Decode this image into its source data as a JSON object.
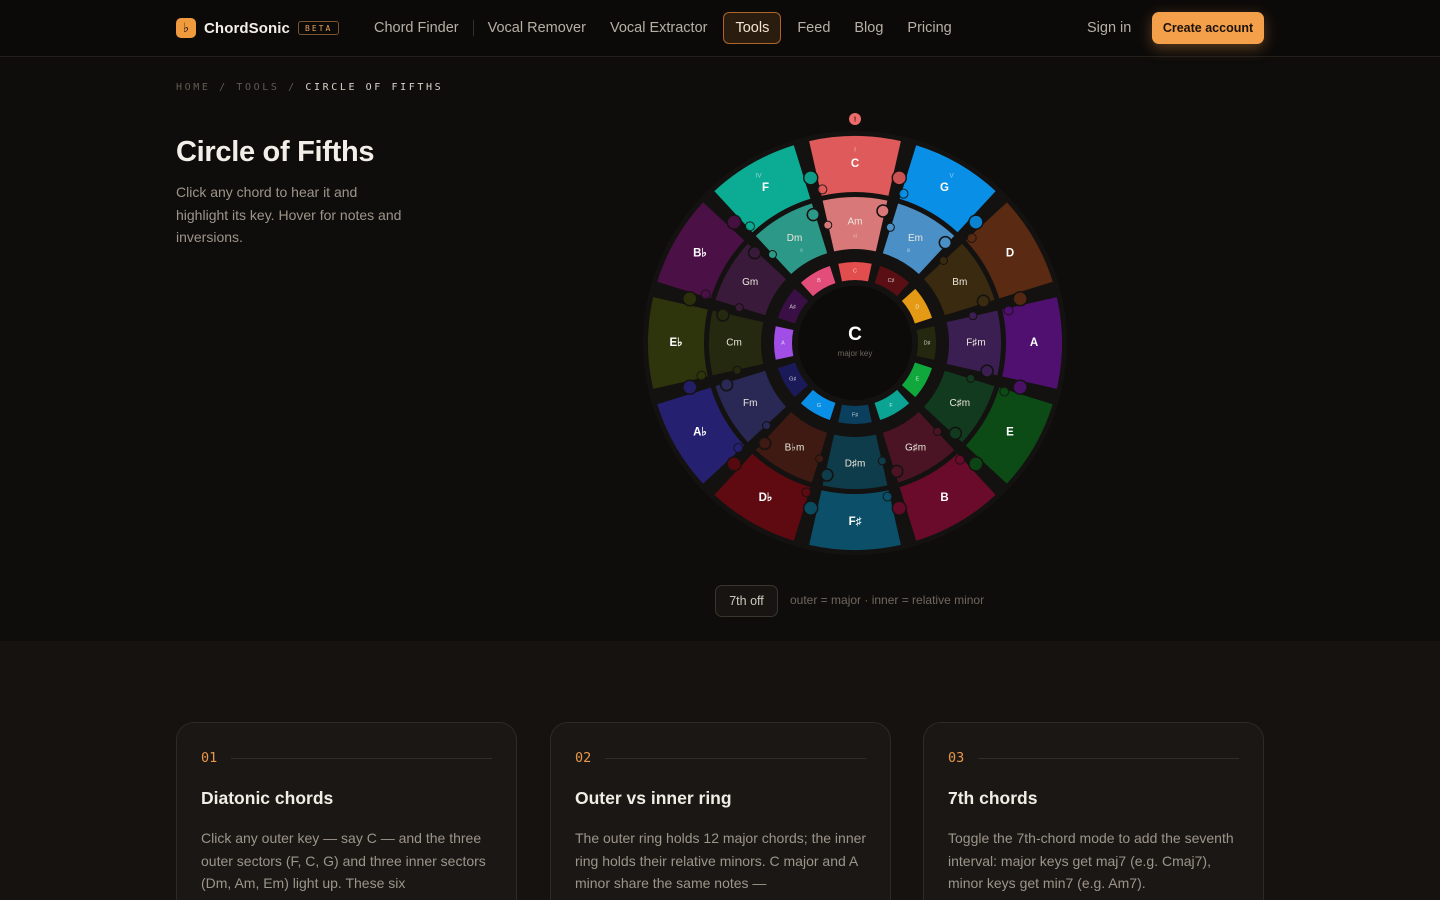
{
  "nav": {
    "brand_glyph": "♭",
    "brand_name": "ChordSonic",
    "brand_badge": "BETA",
    "links": [
      "Chord Finder",
      "Vocal Remover",
      "Vocal Extractor",
      "Tools",
      "Feed",
      "Blog",
      "Pricing"
    ],
    "active_link": "Tools",
    "sign_in": "Sign in",
    "create_account": "Create account"
  },
  "breadcrumb": {
    "home": "HOME",
    "tools": "TOOLS",
    "current": "CIRCLE OF FIFTHS",
    "separator": "/"
  },
  "hero": {
    "title": "Circle of Fifths",
    "subtitle": "Click any chord to hear it and highlight its key. Hover for notes and inversions."
  },
  "wheel": {
    "center_key": "C",
    "center_caption": "major key",
    "top_marker": "!",
    "outer": [
      {
        "label": "C",
        "roman": "I",
        "color": "#df5a5a"
      },
      {
        "label": "G",
        "roman": "V",
        "color": "#0a8fe6"
      },
      {
        "label": "D",
        "color": "#5a2a12"
      },
      {
        "label": "A",
        "color": "#4f1070"
      },
      {
        "label": "E",
        "color": "#0c4a16"
      },
      {
        "label": "B",
        "color": "#6a0b2c"
      },
      {
        "label": "F♯",
        "color": "#0b4f68"
      },
      {
        "label": "D♭",
        "color": "#5e0a10"
      },
      {
        "label": "A♭",
        "color": "#252070"
      },
      {
        "label": "E♭",
        "color": "#2e340b"
      },
      {
        "label": "B♭",
        "color": "#4b1046"
      },
      {
        "label": "F",
        "roman": "IV",
        "color": "#0cab94"
      }
    ],
    "inner": [
      {
        "label": "Am",
        "roman": "vi",
        "color": "#d97878"
      },
      {
        "label": "Em",
        "roman": "iii",
        "color": "#4a8fc6"
      },
      {
        "label": "Bm",
        "color": "#3a2a10"
      },
      {
        "label": "F♯m",
        "color": "#3b1e52"
      },
      {
        "label": "C♯m",
        "color": "#113a1f"
      },
      {
        "label": "G♯m",
        "color": "#4a1424"
      },
      {
        "label": "D♯m",
        "color": "#0f3c4a"
      },
      {
        "label": "B♭m",
        "color": "#3e1a12"
      },
      {
        "label": "Fm",
        "color": "#2a2855"
      },
      {
        "label": "Cm",
        "color": "#25290f"
      },
      {
        "label": "Gm",
        "color": "#3a1a3a"
      },
      {
        "label": "Dm",
        "roman": "ii",
        "color": "#2c9888"
      }
    ],
    "notes": [
      {
        "label": "C",
        "color": "#e24d4d"
      },
      {
        "label": "C♯",
        "color": "#5a0f14"
      },
      {
        "label": "D",
        "color": "#e49a14"
      },
      {
        "label": "D♯",
        "color": "#23280e"
      },
      {
        "label": "E",
        "color": "#10a83c"
      },
      {
        "label": "F",
        "color": "#0aa394"
      },
      {
        "label": "F♯",
        "color": "#0b3f5e"
      },
      {
        "label": "G",
        "color": "#0a8fe6"
      },
      {
        "label": "G♯",
        "color": "#1a1a58"
      },
      {
        "label": "A",
        "color": "#a04ee6"
      },
      {
        "label": "A♯",
        "color": "#3a0f45"
      },
      {
        "label": "B",
        "color": "#e24d7a"
      }
    ]
  },
  "controls": {
    "seventh_toggle": "7th off",
    "legend": "outer = major · inner = relative minor"
  },
  "cards": [
    {
      "num": "01",
      "title": "Diatonic chords",
      "text": "Click any outer key — say C — and the three outer sectors (F, C, G) and three inner sectors (Dm, Am, Em) light up. These six"
    },
    {
      "num": "02",
      "title": "Outer vs inner ring",
      "text": "The outer ring holds 12 major chords; the inner ring holds their relative minors. C major and A minor share the same notes —"
    },
    {
      "num": "03",
      "title": "7th chords",
      "text": "Toggle the 7th-chord mode to add the seventh interval: major keys get maj7 (e.g. Cmaj7), minor keys get min7 (e.g. Am7)."
    }
  ]
}
